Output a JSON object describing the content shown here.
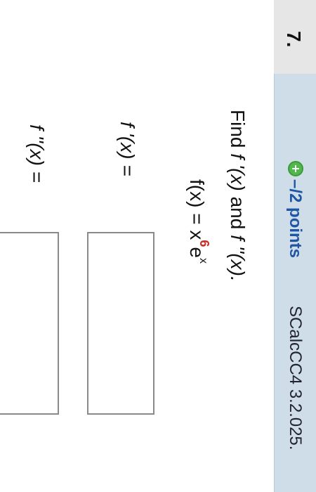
{
  "question": {
    "number": "7.",
    "points": "–/2 points",
    "source": "SCalcCC4 3.2.025."
  },
  "prompt": {
    "find": "Find",
    "f1": "f '(x)",
    "and": "and",
    "f2": "f ''(x).",
    "equation_base": "f(x) = x",
    "exponent": "6",
    "equation_tail": "e",
    "exponent_x": "x"
  },
  "answers": {
    "fprime_label": "f '(x) =",
    "fprime_value": "",
    "fdoubleprime_label": "f ''(x) =",
    "fdoubleprime_value": ""
  },
  "colors": {
    "header": "#cfdde8",
    "points_link": "#1f55a5",
    "exponent_red": "#cc2a22",
    "plus_green": "#51b84b"
  }
}
